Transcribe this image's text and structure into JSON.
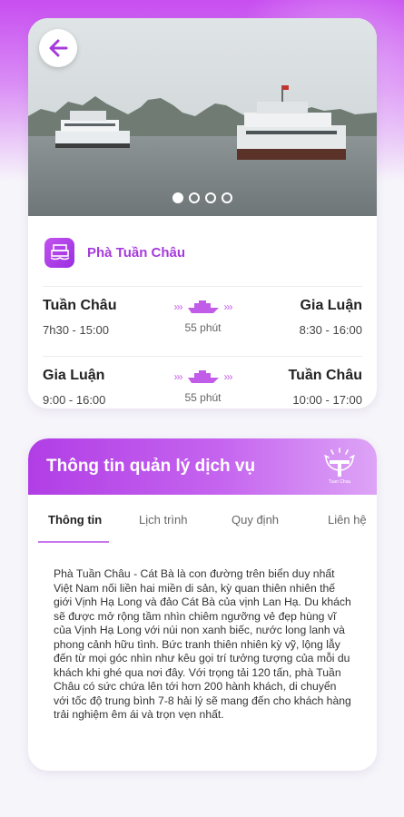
{
  "colors": {
    "accent": "#a63bdc",
    "accent_light": "#c875ee",
    "background": "#f6f5fa"
  },
  "ferry": {
    "name": "Phà Tuần Châu",
    "carousel": {
      "count": 4,
      "active_index": 0
    },
    "routes": [
      {
        "from": "Tuần Châu",
        "from_time": "7h30 - 15:00",
        "duration": "55 phút",
        "to": "Gia Luận",
        "to_time": "8:30 - 16:00"
      },
      {
        "from": "Gia Luận",
        "from_time": "9:00 - 16:00",
        "duration": "55 phút",
        "to": "Tuần Châu",
        "to_time": "10:00 - 17:00"
      }
    ]
  },
  "info": {
    "title": "Thông tin quản lý dịch vụ",
    "logo_text": "Tuan Chau",
    "tabs": [
      "Thông tin",
      "Lịch trình",
      "Quy định",
      "Liên hệ"
    ],
    "active_tab": 0,
    "description": "Phà Tuần Châu - Cát Bà là con đường trên biển duy nhất Việt Nam nối liền hai miền di sản, kỳ quan thiên nhiên thế giới Vịnh Hạ Long và đảo Cát Bà của vịnh Lan Hạ. Du khách sẽ được mở rộng tầm nhìn chiêm ngưỡng vẻ đẹp hùng vĩ của Vịnh Hạ Long với núi non xanh biếc, nước long lanh và phong cảnh hữu tình. Bức tranh thiên nhiên kỳ vỹ, lộng lẫy đến từ mọi góc nhìn như kêu gọi trí tưởng tượng của mỗi du khách khi ghé qua nơi đây. Với trọng tải 120 tấn, phà Tuần Châu có sức chứa lên tới hơn 200 hành khách, di chuyển với tốc độ trung bình 7-8 hải lý sẽ mang đến cho khách hàng trải nghiệm êm ái và trọn vẹn nhất."
  }
}
